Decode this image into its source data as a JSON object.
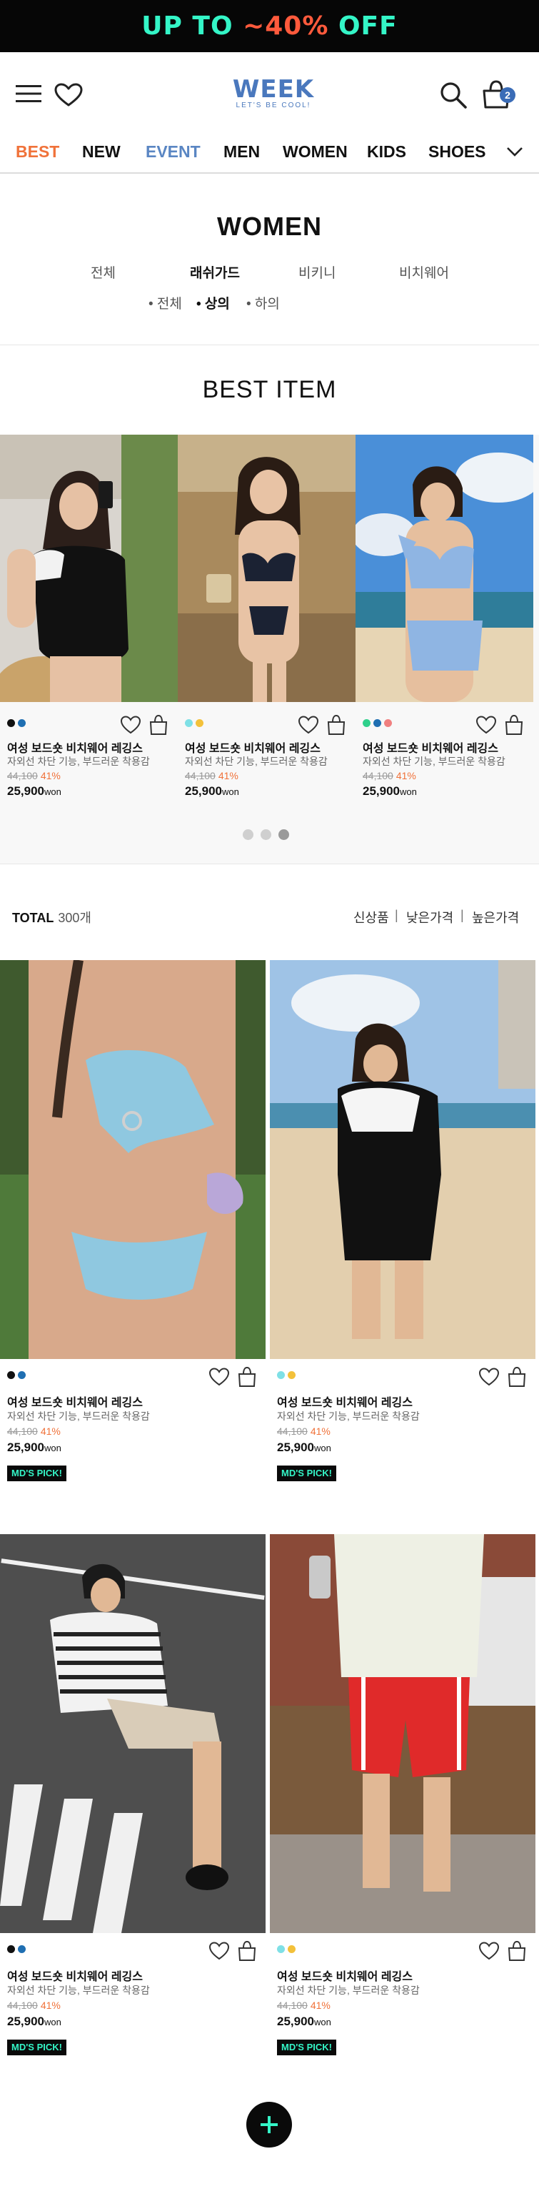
{
  "promo": {
    "text_a": "UP TO ",
    "text_b": "~40%",
    "text_c": " OFF"
  },
  "header": {
    "logo_main": "WEEK",
    "logo_sub": "LET'S BE COOL!",
    "cart_count": "2",
    "icons": [
      "menu-icon",
      "heart-icon",
      "search-icon",
      "bag-icon"
    ]
  },
  "nav": {
    "items": [
      "BEST",
      "NEW",
      "EVENT",
      "MEN",
      "WOMEN",
      "KIDS",
      "SHOES"
    ],
    "colors": {
      "best": "#f0723a",
      "event": "#5a86c3"
    }
  },
  "category": {
    "title": "WOMEN",
    "tabs": [
      "전체",
      "래쉬가드",
      "비키니",
      "비치웨어"
    ],
    "active_tab": "래쉬가드",
    "subtabs": [
      "• 전체",
      "• 상의",
      "• 하의"
    ],
    "active_subtab": "• 상의"
  },
  "best": {
    "title": "BEST ITEM",
    "items": [
      {
        "name": "여성 보드숏 비치웨어 레깅스",
        "desc": "자외선 차단 기능, 부드러운 착용감",
        "orig": "44,100",
        "disc": "41%",
        "price": "25,900",
        "won": "won",
        "swatches": [
          "#111111",
          "#1f6fb2"
        ]
      },
      {
        "name": "여성 보드숏 비치웨어 레깅스",
        "desc": "자외선 차단 기능, 부드러운 착용감",
        "orig": "44,100",
        "disc": "41%",
        "price": "25,900",
        "won": "won",
        "swatches": [
          "#7fe0e6",
          "#f3c13a"
        ]
      },
      {
        "name": "여성 보드숏 비치웨어 레깅스",
        "desc": "자외선 차단 기능, 부드러운 착용감",
        "orig": "44,100",
        "disc": "41%",
        "price": "25,900",
        "won": "won",
        "swatches": [
          "#2fd08b",
          "#1f6fb2",
          "#f08080"
        ]
      }
    ],
    "page_indicator": {
      "count": 3,
      "active": 3
    }
  },
  "listing": {
    "total_label": "TOTAL",
    "total_count": "300개",
    "sort": [
      "신상품",
      "낮은가격",
      "높은가격"
    ],
    "sort_sep": "|",
    "products": [
      {
        "name": "여성 보드숏 비치웨어 레깅스",
        "desc": "자외선 차단 기능, 부드러운 착용감",
        "orig": "44,100",
        "disc": "41%",
        "price": "25,900",
        "won": "won",
        "badge": "MD'S PICK!",
        "swatches": [
          "#111111",
          "#1f6fb2"
        ]
      },
      {
        "name": "여성 보드숏 비치웨어 레깅스",
        "desc": "자외선 차단 기능, 부드러운 착용감",
        "orig": "44,100",
        "disc": "41%",
        "price": "25,900",
        "won": "won",
        "badge": "MD'S PICK!",
        "swatches": [
          "#7fe0e6",
          "#f3c13a"
        ]
      },
      {
        "name": "여성 보드숏 비치웨어 레깅스",
        "desc": "자외선 차단 기능, 부드러운 착용감",
        "orig": "44,100",
        "disc": "41%",
        "price": "25,900",
        "won": "won",
        "badge": "MD'S PICK!",
        "swatches": [
          "#111111",
          "#1f6fb2"
        ]
      },
      {
        "name": "여성 보드숏 비치웨어 레깅스",
        "desc": "자외선 차단 기능, 부드러운 착용감",
        "orig": "44,100",
        "disc": "41%",
        "price": "25,900",
        "won": "won",
        "badge": "MD'S PICK!",
        "swatches": [
          "#7fe0e6",
          "#f3c13a"
        ]
      }
    ]
  },
  "fab": {
    "icon": "plus-icon"
  }
}
